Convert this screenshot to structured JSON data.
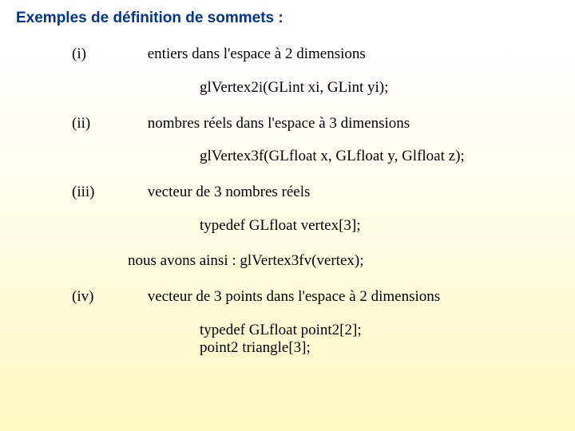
{
  "title": "Exemples de définition de sommets :",
  "items": [
    {
      "label": "(i)",
      "desc": "entiers dans l'espace à 2 dimensions",
      "code": "glVertex2i(GLint xi, GLint yi);"
    },
    {
      "label": "(ii)",
      "desc": "nombres réels dans l'espace à 3 dimensions",
      "code": "glVertex3f(GLfloat x, GLfloat y, Glfloat z);"
    },
    {
      "label": "(iii)",
      "desc": "vecteur de 3 nombres réels",
      "code": "typedef GLfloat vertex[3];",
      "note": "nous avons ainsi : glVertex3fv(vertex);"
    },
    {
      "label": "(iv)",
      "desc": "vecteur de 3 points dans l'espace à 2 dimensions",
      "code": "typedef GLfloat point2[2];\npoint2 triangle[3];"
    }
  ]
}
